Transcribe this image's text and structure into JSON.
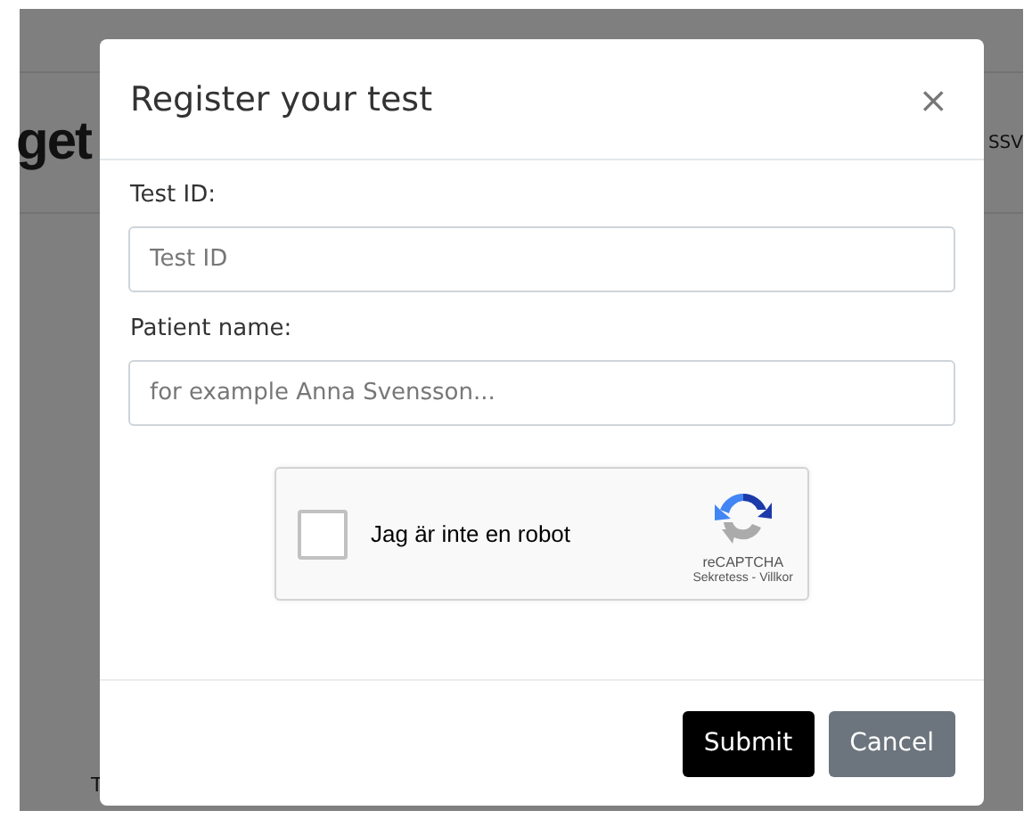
{
  "background_page": {
    "logo_text": "get",
    "header_text": "SSV",
    "footer_text": "T"
  },
  "modal": {
    "title": "Register your test",
    "close": "×",
    "fields": [
      {
        "label": "Test ID:",
        "placeholder": "Test ID"
      },
      {
        "label": "Patient name:",
        "placeholder": "for example Anna Svensson..."
      }
    ],
    "captcha": {
      "checked": false,
      "label": "Jag är inte en robot",
      "brand": "reCAPTCHA",
      "links": "Sekretess - Villkor"
    },
    "buttons": [
      {
        "label": "Submit",
        "kind": "primary"
      },
      {
        "label": "Cancel",
        "kind": "secondary"
      }
    ]
  }
}
